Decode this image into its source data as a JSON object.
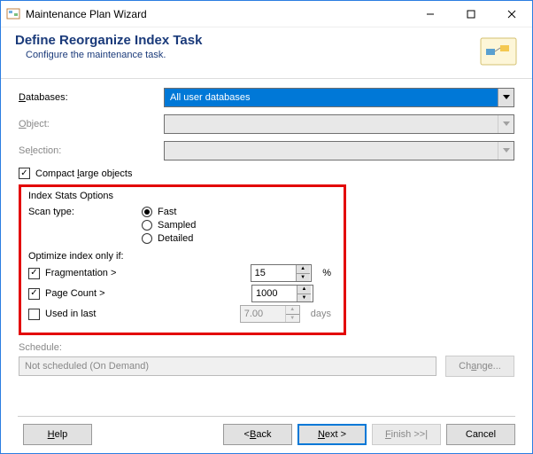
{
  "window": {
    "title": "Maintenance Plan Wizard"
  },
  "header": {
    "title": "Define Reorganize Index Task",
    "subtitle": "Configure the maintenance task."
  },
  "form": {
    "databases_label": "Databases:",
    "databases_value": "All user databases",
    "object_label": "Object:",
    "object_value": "",
    "selection_label": "Selection:",
    "selection_value": ""
  },
  "compact_checkbox": {
    "label": "Compact large objects",
    "checked": true
  },
  "index_stats": {
    "group_label": "Index Stats Options",
    "scan_type_label": "Scan type:",
    "scan_options": {
      "fast": "Fast",
      "sampled": "Sampled",
      "detailed": "Detailed"
    },
    "scan_selected": "fast",
    "optimize_label": "Optimize index only if:",
    "fragmentation": {
      "label": "Fragmentation >",
      "checked": true,
      "value": "15",
      "unit": "%"
    },
    "page_count": {
      "label": "Page Count >",
      "checked": true,
      "value": "1000",
      "unit": ""
    },
    "used_in_last": {
      "label": "Used  in last",
      "checked": false,
      "value": "7.00",
      "unit": "days"
    }
  },
  "schedule": {
    "label": "Schedule:",
    "value": "Not scheduled (On Demand)",
    "change_btn": "Change..."
  },
  "footer": {
    "help": "Help",
    "back": "< Back",
    "next": "Next >",
    "finish": "Finish >>|",
    "cancel": "Cancel"
  }
}
